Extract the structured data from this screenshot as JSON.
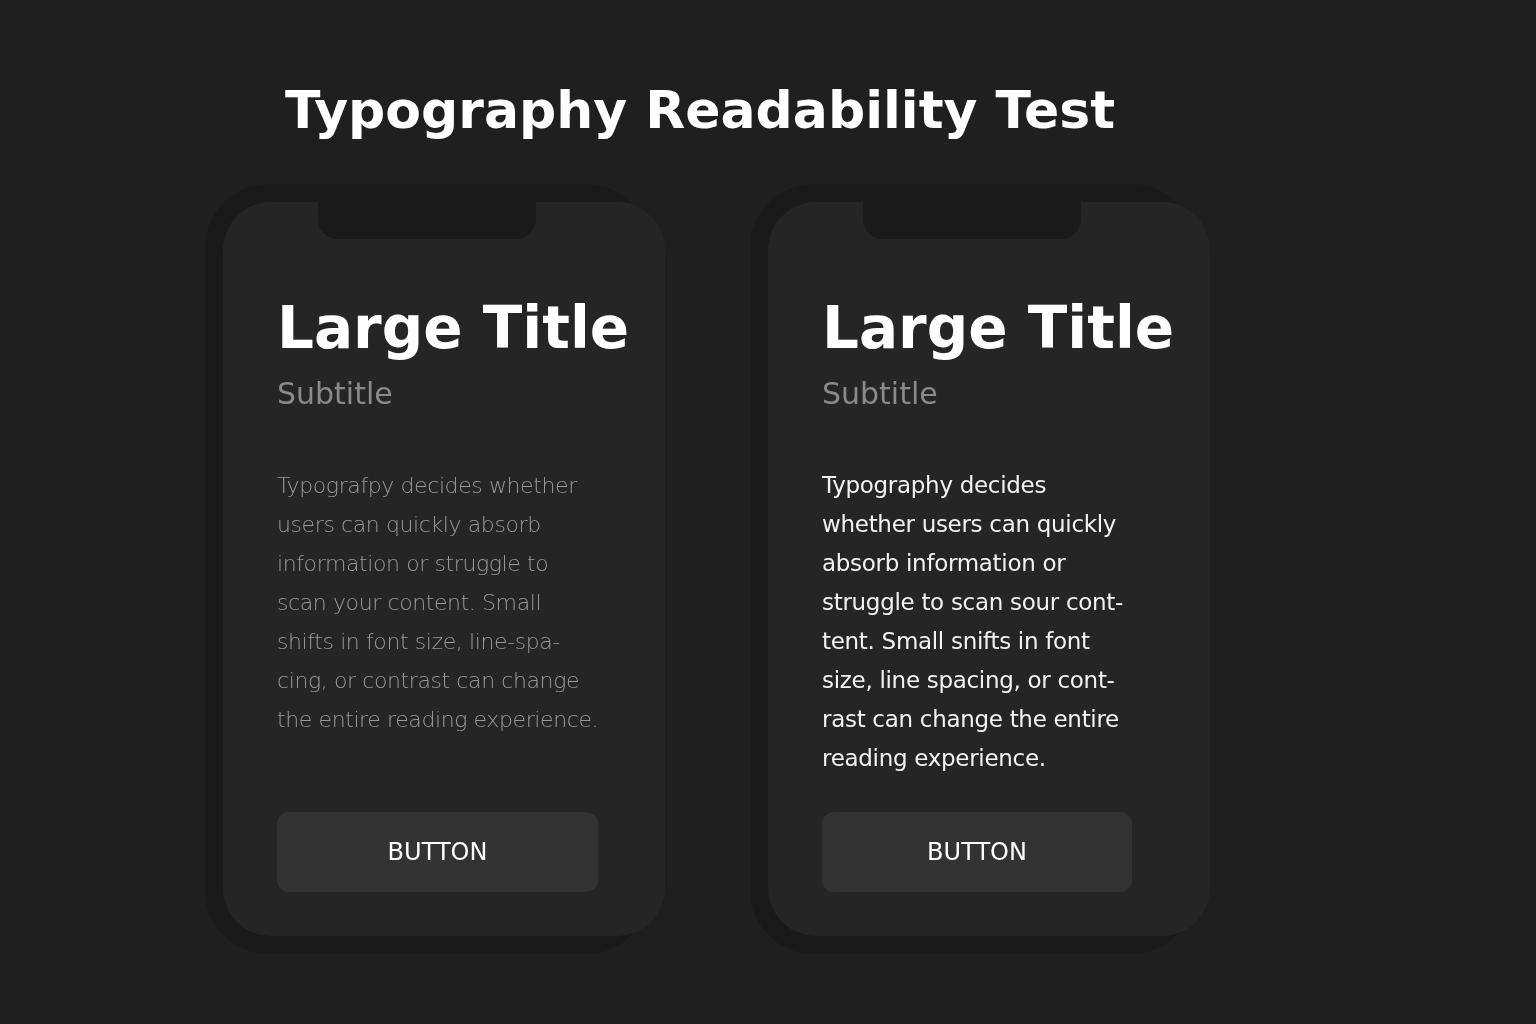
{
  "title": "Typography Readability Test",
  "phones": [
    {
      "kind": "low-contrast",
      "heading": "Large Title",
      "subtitle": "Subtitle",
      "body_lines": [
        "Typografpy decides whether",
        "users can quickly absorb",
        "information or struggle to",
        "scan your content. Small",
        "shifts in font size, line-spa-",
        "cing, or contrast can change",
        "the entire reading experience."
      ],
      "button": "BUTTON"
    },
    {
      "kind": "high-contrast",
      "heading": "Large Title",
      "subtitle": "Subtitle",
      "body_lines": [
        "Typography decides",
        "whether users can quickly",
        "absorb information or",
        "struggle to scan sour cont-",
        "tent. Small snifts in font",
        "size, line spacing, or cont-",
        "rast can change the entire",
        "reading experience."
      ],
      "button": "BUTTON"
    }
  ]
}
